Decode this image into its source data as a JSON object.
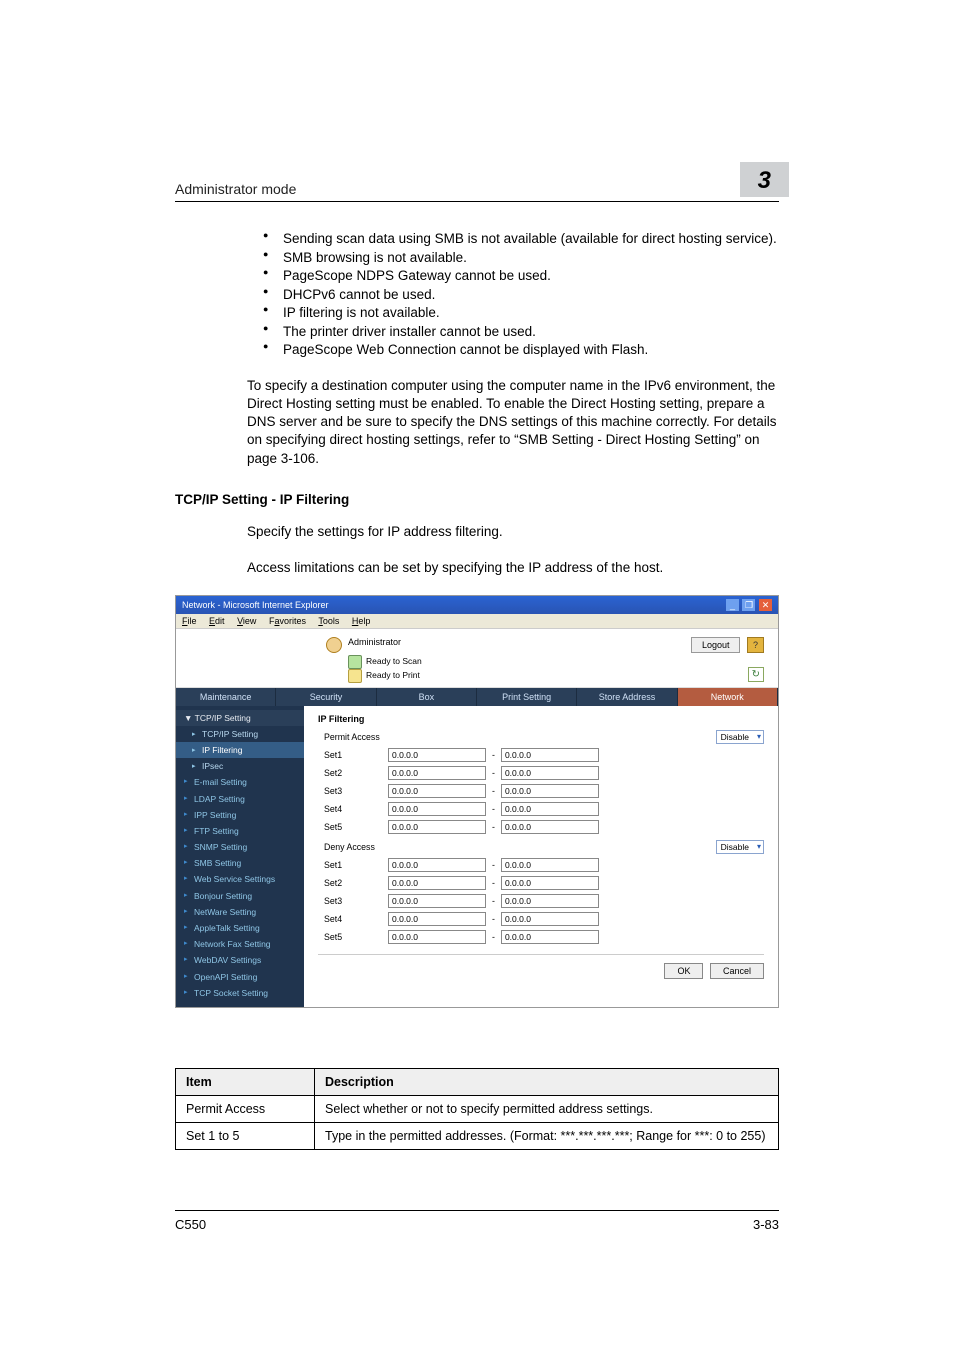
{
  "header": {
    "title": "Administrator mode",
    "chapter": "3"
  },
  "bullets": [
    "Sending scan data using SMB is not available (available for direct hosting service).",
    "SMB browsing is not available.",
    "PageScope NDPS Gateway cannot be used.",
    "DHCPv6 cannot be used.",
    "IP filtering is not available.",
    "The printer driver installer cannot be used.",
    "PageScope Web Connection cannot be displayed with Flash."
  ],
  "para1": "To specify a destination computer using the computer name in the IPv6 environment, the Direct Hosting setting must be enabled. To enable the Direct Hosting setting, prepare a DNS server and be sure to specify the DNS settings of this machine correctly. For details on specifying direct hosting settings, refer to “SMB Setting - Direct Hosting Setting” on page 3-106.",
  "subheading": "TCP/IP Setting - IP Filtering",
  "para2": "Specify the settings for IP address filtering.",
  "para3": "Access limitations can be set by specifying the IP address of the host.",
  "screenshot": {
    "window_title": "Network - Microsoft Internet Explorer",
    "menubar": [
      "File",
      "Edit",
      "View",
      "Favorites",
      "Tools",
      "Help"
    ],
    "admin_label": "Administrator",
    "status_scan": "Ready to Scan",
    "status_print": "Ready to Print",
    "logout": "Logout",
    "help": "?",
    "tabs": [
      "Maintenance",
      "Security",
      "Box",
      "Print Setting",
      "Store Address",
      "Network"
    ],
    "active_tab_index": 5,
    "sidebar": {
      "group": "▼ TCP/IP Setting",
      "group_subs": [
        "TCP/IP Setting",
        "IP Filtering",
        "IPsec"
      ],
      "selected_sub_index": 1,
      "items": [
        "E-mail Setting",
        "LDAP Setting",
        "IPP Setting",
        "FTP Setting",
        "SNMP Setting",
        "SMB Setting",
        "Web Service Settings",
        "Bonjour Setting",
        "NetWare Setting",
        "AppleTalk Setting",
        "Network Fax Setting",
        "WebDAV Settings",
        "OpenAPI Setting",
        "TCP Socket Setting"
      ]
    },
    "main": {
      "title": "IP Filtering",
      "permit_label": "Permit Access",
      "deny_label": "Deny Access",
      "disable": "Disable",
      "sets": [
        {
          "label": "Set1",
          "a": "0.0.0.0",
          "b": "0.0.0.0"
        },
        {
          "label": "Set2",
          "a": "0.0.0.0",
          "b": "0.0.0.0"
        },
        {
          "label": "Set3",
          "a": "0.0.0.0",
          "b": "0.0.0.0"
        },
        {
          "label": "Set4",
          "a": "0.0.0.0",
          "b": "0.0.0.0"
        },
        {
          "label": "Set5",
          "a": "0.0.0.0",
          "b": "0.0.0.0"
        }
      ],
      "ok": "OK",
      "cancel": "Cancel"
    }
  },
  "desc_table": {
    "headers": [
      "Item",
      "Description"
    ],
    "rows": [
      [
        "Permit Access",
        "Select whether or not to specify permitted address settings."
      ],
      [
        "Set 1 to 5",
        "Type in the permitted addresses. (Format: ***.***.***.***; Range for ***: 0 to 255)"
      ]
    ]
  },
  "footer": {
    "left": "C550",
    "right": "3-83"
  }
}
